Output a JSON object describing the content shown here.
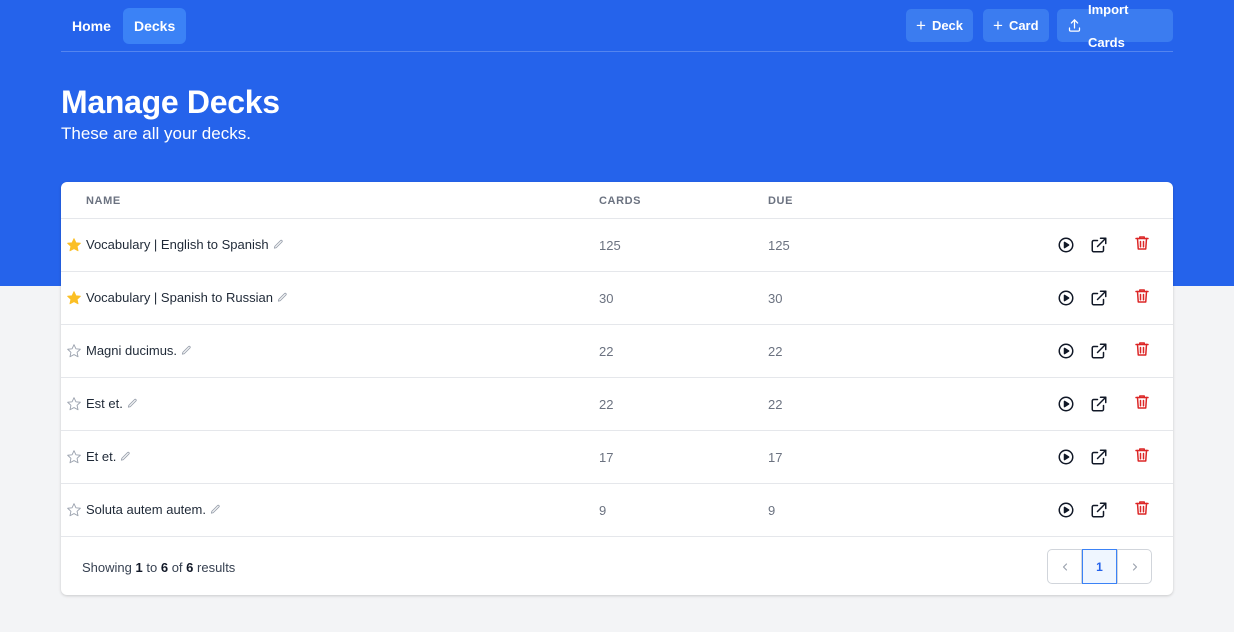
{
  "nav": {
    "home_label": "Home",
    "decks_label": "Decks"
  },
  "actions": {
    "deck_label": "Deck",
    "card_label": "Card",
    "import_label": "Import Cards"
  },
  "header": {
    "title": "Manage Decks",
    "subtitle": "These are all your decks."
  },
  "table": {
    "columns": {
      "name": "NAME",
      "cards": "CARDS",
      "due": "DUE"
    },
    "rows": [
      {
        "name": "Vocabulary | English to Spanish",
        "cards": "125",
        "due": "125",
        "starred": true
      },
      {
        "name": "Vocabulary | Spanish to Russian",
        "cards": "30",
        "due": "30",
        "starred": true
      },
      {
        "name": "Magni ducimus.",
        "cards": "22",
        "due": "22",
        "starred": false
      },
      {
        "name": "Est et.",
        "cards": "22",
        "due": "22",
        "starred": false
      },
      {
        "name": "Et et.",
        "cards": "17",
        "due": "17",
        "starred": false
      },
      {
        "name": "Soluta autem autem.",
        "cards": "9",
        "due": "9",
        "starred": false
      }
    ]
  },
  "pagination": {
    "showing_prefix": "Showing",
    "from": "1",
    "to_word": "to",
    "to": "6",
    "of_word": "of",
    "total": "6",
    "results_word": "results",
    "current_page": "1"
  },
  "colors": {
    "brand_blue": "#2563eb",
    "star_filled": "#fbbf24",
    "delete_red": "#dc2626"
  },
  "icons": [
    "plus-icon",
    "upload-icon",
    "star-icon",
    "pencil-icon",
    "play-icon",
    "external-link-icon",
    "trash-icon",
    "chevron-left-icon",
    "chevron-right-icon"
  ]
}
